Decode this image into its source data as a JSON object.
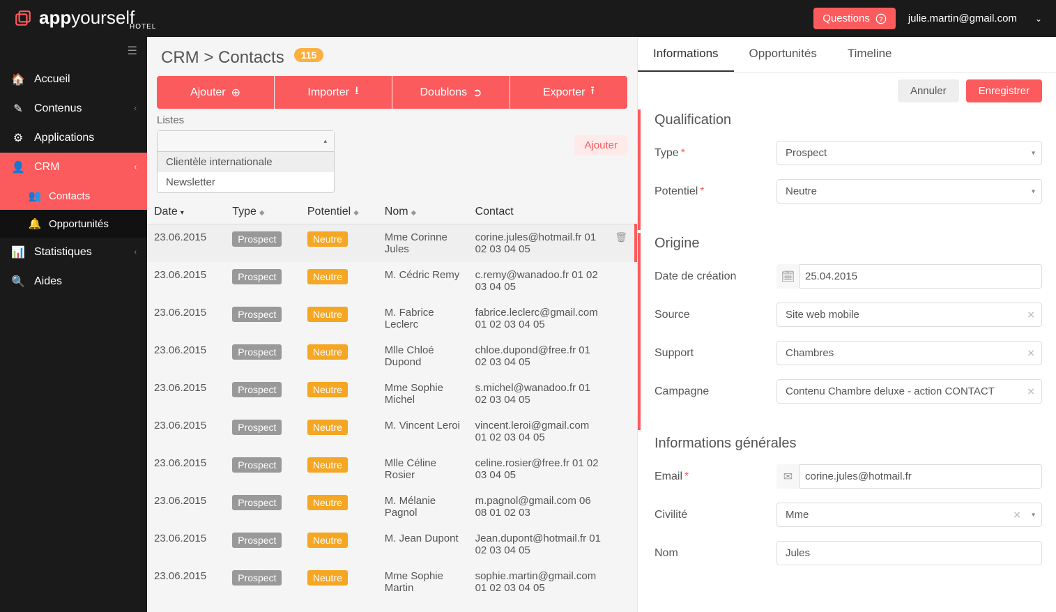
{
  "brand": {
    "app_left": "app",
    "app_right": "yourself",
    "sub": "HOTEL"
  },
  "topbar": {
    "questions_label": "Questions",
    "user_email": "julie.martin@gmail.com"
  },
  "sidebar": {
    "items": [
      {
        "label": "Accueil"
      },
      {
        "label": "Contenus"
      },
      {
        "label": "Applications"
      },
      {
        "label": "CRM",
        "active": true
      },
      {
        "label": "Statistiques"
      },
      {
        "label": "Aides"
      }
    ],
    "sub": [
      {
        "label": "Contacts",
        "active": true
      },
      {
        "label": "Opportunités"
      }
    ]
  },
  "breadcrumb": {
    "path": "CRM > Contacts",
    "count": "115"
  },
  "actions": {
    "ajouter": "Ajouter",
    "importer": "Importer",
    "doublons": "Doublons",
    "exporter": "Exporter"
  },
  "filter": {
    "label": "Listes",
    "options": [
      "Clientèle internationale",
      "Newsletter"
    ],
    "side_button": "Ajouter"
  },
  "table": {
    "headers": {
      "date": "Date",
      "type": "Type",
      "potentiel": "Potentiel",
      "nom": "Nom",
      "contact": "Contact"
    },
    "rows": [
      {
        "date": "23.06.2015",
        "type": "Prospect",
        "pot": "Neutre",
        "nom": "Mme Corinne Jules",
        "contact": "corine.jules@hotmail.fr 01 02 03 04 05",
        "selected": true
      },
      {
        "date": "23.06.2015",
        "type": "Prospect",
        "pot": "Neutre",
        "nom": "M. Cédric Remy",
        "contact": "c.remy@wanadoo.fr 01 02 03 04 05"
      },
      {
        "date": "23.06.2015",
        "type": "Prospect",
        "pot": "Neutre",
        "nom": "M. Fabrice Leclerc",
        "contact": "fabrice.leclerc@gmail.com 01 02 03 04 05"
      },
      {
        "date": "23.06.2015",
        "type": "Prospect",
        "pot": "Neutre",
        "nom": "Mlle Chloé Dupond",
        "contact": "chloe.dupond@free.fr 01 02 03 04 05"
      },
      {
        "date": "23.06.2015",
        "type": "Prospect",
        "pot": "Neutre",
        "nom": "Mme Sophie Michel",
        "contact": "s.michel@wanadoo.fr 01 02 03 04 05"
      },
      {
        "date": "23.06.2015",
        "type": "Prospect",
        "pot": "Neutre",
        "nom": "M. Vincent Leroi",
        "contact": "vincent.leroi@gmail.com 01 02 03 04 05"
      },
      {
        "date": "23.06.2015",
        "type": "Prospect",
        "pot": "Neutre",
        "nom": "Mlle Céline Rosier",
        "contact": "celine.rosier@free.fr 01 02 03 04 05"
      },
      {
        "date": "23.06.2015",
        "type": "Prospect",
        "pot": "Neutre",
        "nom": "M. Mélanie Pagnol",
        "contact": "m.pagnol@gmail.com 06 08 01 02 03"
      },
      {
        "date": "23.06.2015",
        "type": "Prospect",
        "pot": "Neutre",
        "nom": "M. Jean Dupont",
        "contact": "Jean.dupont@hotmail.fr 01 02 03 04 05"
      },
      {
        "date": "23.06.2015",
        "type": "Prospect",
        "pot": "Neutre",
        "nom": "Mme Sophie Martin",
        "contact": "sophie.martin@gmail.com 01 02 03 04 05"
      }
    ]
  },
  "detail": {
    "tabs": [
      "Informations",
      "Opportunités",
      "Timeline"
    ],
    "cancel": "Annuler",
    "save": "Enregistrer",
    "sections": {
      "qualification": {
        "title": "Qualification",
        "type_label": "Type",
        "type_value": "Prospect",
        "pot_label": "Potentiel",
        "pot_value": "Neutre"
      },
      "origine": {
        "title": "Origine",
        "date_label": "Date de création",
        "date_value": "25.04.2015",
        "source_label": "Source",
        "source_value": "Site web mobile",
        "support_label": "Support",
        "support_value": "Chambres",
        "camp_label": "Campagne",
        "camp_value": "Contenu Chambre deluxe - action CONTACT"
      },
      "info": {
        "title": "Informations générales",
        "email_label": "Email",
        "email_value": "corine.jules@hotmail.fr",
        "civ_label": "Civilité",
        "civ_value": "Mme",
        "nom_label": "Nom",
        "nom_value": "Jules"
      }
    }
  }
}
